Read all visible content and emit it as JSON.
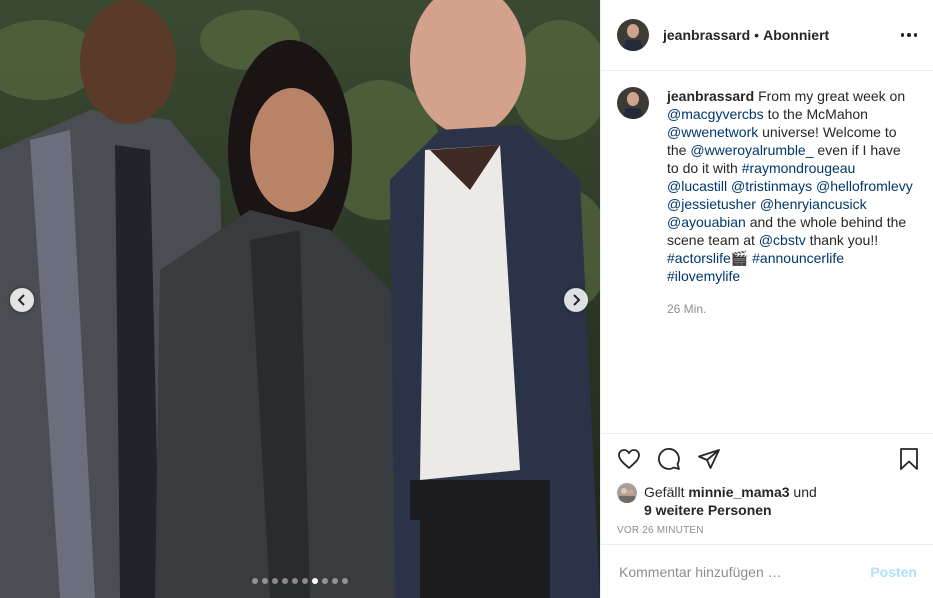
{
  "post": {
    "username": "jeanbrassard",
    "separator": "•",
    "follow_status": "Abonniert",
    "caption_segments": [
      {
        "text": "From my great week on ",
        "type": "text"
      },
      {
        "text": "@macgyvercbs",
        "type": "link"
      },
      {
        "text": " to the McMahon ",
        "type": "text"
      },
      {
        "text": "@wwenetwork",
        "type": "link"
      },
      {
        "text": " universe! Welcome to the ",
        "type": "text"
      },
      {
        "text": "@wweroyalrumble_",
        "type": "link"
      },
      {
        "text": " even if I have to do it with ",
        "type": "text"
      },
      {
        "text": "#raymondrougeau",
        "type": "link"
      },
      {
        "text": " ",
        "type": "text"
      },
      {
        "text": "@lucastill",
        "type": "link"
      },
      {
        "text": " ",
        "type": "text"
      },
      {
        "text": "@tristinmays",
        "type": "link"
      },
      {
        "text": " ",
        "type": "text"
      },
      {
        "text": "@hellofromlevy",
        "type": "link"
      },
      {
        "text": " ",
        "type": "text"
      },
      {
        "text": "@jessietusher",
        "type": "link"
      },
      {
        "text": " ",
        "type": "text"
      },
      {
        "text": "@henryiancusick",
        "type": "link"
      },
      {
        "text": " ",
        "type": "text"
      },
      {
        "text": "@ayouabian",
        "type": "link"
      },
      {
        "text": " and the whole behind the scene team at ",
        "type": "text"
      },
      {
        "text": "@cbstv",
        "type": "link"
      },
      {
        "text": " thank you!! ",
        "type": "text"
      },
      {
        "text": "#actorslife",
        "type": "link"
      },
      {
        "text": "🎬",
        "type": "text"
      },
      {
        "text": " ",
        "type": "text"
      },
      {
        "text": "#announcerlife",
        "type": "link"
      },
      {
        "text": " ",
        "type": "text"
      },
      {
        "text": "#ilovemylife",
        "type": "link"
      }
    ],
    "caption_age": "26 Min.",
    "likes_prefix": "Gefällt ",
    "likes_user": "minnie_mama3",
    "likes_middle": " und",
    "likes_others": "9 weitere Personen",
    "posted_time": "VOR 26 MINUTEN",
    "comment_placeholder": "Kommentar hinzufügen …",
    "post_label": "Posten"
  },
  "carousel": {
    "dot_count": 10,
    "active_index": 6
  },
  "icons": {
    "like": "heart-icon",
    "comment": "comment-icon",
    "share": "paper-plane-icon",
    "save": "bookmark-icon",
    "more": "more-options-icon",
    "prev": "chevron-left-icon",
    "next": "chevron-right-icon"
  },
  "colors": {
    "link": "#00376b",
    "muted": "#8e8e8e",
    "post_disabled": "#b2dffc"
  }
}
